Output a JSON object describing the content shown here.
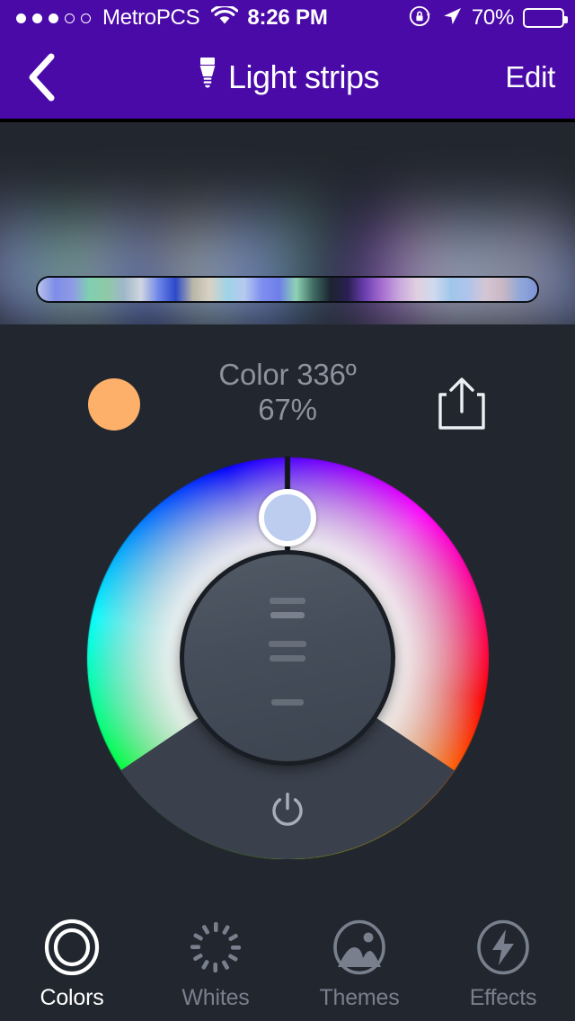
{
  "status_bar": {
    "signal_dots_filled": 3,
    "signal_dots_total": 5,
    "carrier": "MetroPCS",
    "wifi_icon": "wifi-icon",
    "time": "8:26 PM",
    "rotation_lock_icon": "rotation-lock-icon",
    "location_icon": "location-arrow-icon",
    "battery_percent": "70%",
    "battery_level": 70
  },
  "nav_bar": {
    "back_icon": "chevron-left-icon",
    "bulb_icon": "light-bulb-icon",
    "title": "Light strips",
    "edit_label": "Edit",
    "background_color": "#4a0aa8"
  },
  "preview": {
    "strip_name": "light-strip-preview",
    "strip_colors": [
      "#b9c4ea",
      "#7f8de8",
      "#8f9ae6",
      "#7fd0b0",
      "#8ec9a6",
      "#9fb7c9",
      "#cfd6e0",
      "#6f86e8",
      "#2c49c8",
      "#b9b6a8",
      "#d8d2c4",
      "#9fd4e8",
      "#b6c9ef",
      "#7f8ff0",
      "#6d7fe8",
      "#8fd2b4",
      "#3f6b62",
      "#1b2430",
      "#2a1f52",
      "#6b3fb0",
      "#a76fd0",
      "#c9a8dc",
      "#e0cfe0",
      "#cfd9ee",
      "#9fc6ea",
      "#b0c4ea",
      "#d4c6d4",
      "#c9b7c4",
      "#8fa8d8",
      "#7f93d8"
    ]
  },
  "color_info": {
    "swatch_color": "#fdb069",
    "line1": "Color 336º",
    "line2": "67%",
    "hue_degrees": 336,
    "brightness_percent": 67,
    "share_icon": "share-icon"
  },
  "color_wheel": {
    "name": "hue-saturation-wheel",
    "selector_color": "#bccdf0",
    "selector_angle_degrees": 0,
    "knob_tick_count": 5,
    "power_icon": "power-icon",
    "wheel_hues": [
      "#2b1ecd",
      "#4a2ae0",
      "#7a1fd0",
      "#a01ac0",
      "#c41ba0",
      "#d41a74",
      "#d8204a",
      "#cf2020",
      "#c94a12",
      "#c97a10",
      "#b59a10",
      "#6aa820",
      "#21b43e",
      "#18b878",
      "#17b0a8",
      "#1b9ad0",
      "#1f74dd",
      "#2340d8"
    ]
  },
  "tab_bar": {
    "items": [
      {
        "label": "Colors",
        "icon": "colors-ring-icon",
        "active": true
      },
      {
        "label": "Whites",
        "icon": "whites-dashed-icon",
        "active": false
      },
      {
        "label": "Themes",
        "icon": "themes-photo-icon",
        "active": false
      },
      {
        "label": "Effects",
        "icon": "effects-bolt-icon",
        "active": false
      }
    ]
  }
}
